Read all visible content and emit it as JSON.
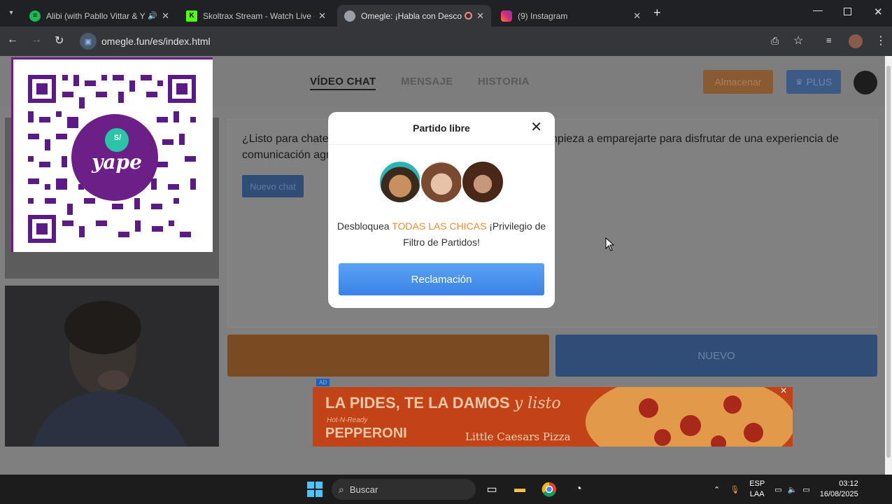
{
  "browser": {
    "tabs": [
      {
        "title": "Alibi (with Pabllo Vittar & Yseult)",
        "favicon": "spotify-icon",
        "color": "#1db954"
      },
      {
        "title": "Skoltrax Stream - Watch Live on Kick",
        "favicon": "kick-icon",
        "color": "#53fc18"
      },
      {
        "title": "Omegle: ¡Habla con Desconocidos!",
        "favicon": "globe-icon",
        "color": "#9aa0a6"
      },
      {
        "title": "(9) Instagram",
        "favicon": "instagram-icon",
        "color": "#e1306c"
      }
    ],
    "url": "omegle.fun/es/index.html"
  },
  "site": {
    "nav": [
      "VÍDEO CHAT",
      "MENSAJE",
      "HISTORIA"
    ],
    "store_button": "Almacenar",
    "plus_button": "PLUS",
    "welcome": "¿Listo para chatear con nuevos amigos de todo el mundo? ¡Empieza a emparejarte para disfrutar de una experiencia de comunicación agradable y divertida! 🌏 💭",
    "new_chat_button": "Nuevo chat",
    "next_button": "NUEVO",
    "ad_tag": "AD",
    "ad_headline": "LA PIDES, TE LA DAMOS",
    "ad_script": "y listo",
    "ad_sub": "Hot-N-Ready",
    "ad_product": "PEPPERONI",
    "ad_brand": "Little Caesars Pizza",
    "qr_label": "yape",
    "qr_currency": "S/"
  },
  "modal": {
    "title": "Partido libre",
    "text_before": "Desbloquea",
    "text_highlight": "TODAS LAS CHICAS",
    "text_after": "¡Privilegio de Filtro de Partidos!",
    "button": "Reclamación"
  },
  "taskbar": {
    "search_placeholder": "Buscar",
    "lang": "ESP",
    "layout": "LAA",
    "time": "03:12",
    "date": "16/08/2025"
  }
}
